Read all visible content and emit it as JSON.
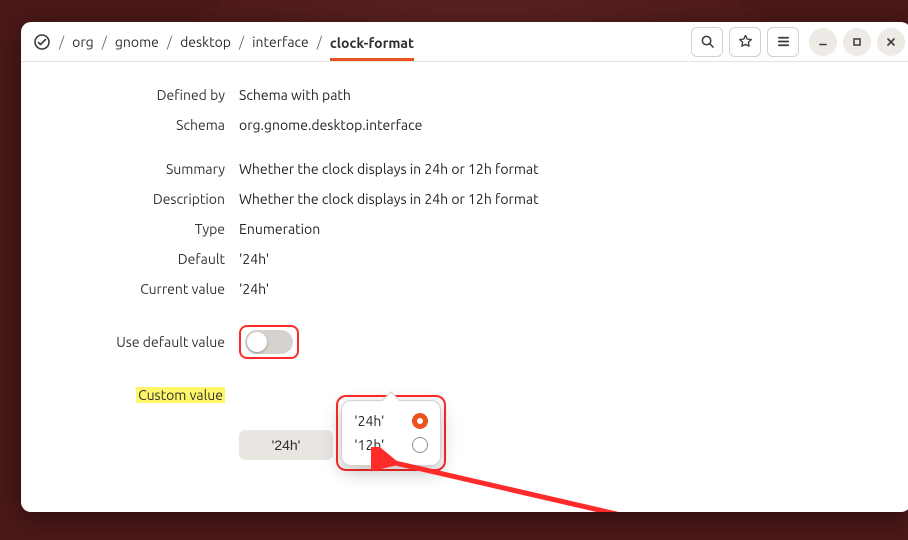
{
  "breadcrumb": {
    "items": [
      "org",
      "gnome",
      "desktop",
      "interface",
      "clock-format"
    ],
    "active_index": 4
  },
  "rows": {
    "defined_by": {
      "label": "Defined by",
      "value": "Schema with path"
    },
    "schema": {
      "label": "Schema",
      "value": "org.gnome.desktop.interface"
    },
    "summary": {
      "label": "Summary",
      "value": "Whether the clock displays in 24h or 12h format"
    },
    "description": {
      "label": "Description",
      "value": "Whether the clock displays in 24h or 12h format"
    },
    "type": {
      "label": "Type",
      "value": "Enumeration"
    },
    "default": {
      "label": "Default",
      "value": "'24h'"
    },
    "current": {
      "label": "Current value",
      "value": "'24h'"
    },
    "use_default": {
      "label": "Use default value",
      "on": false
    },
    "custom": {
      "label": "Custom value",
      "selected": "'24h'",
      "options": [
        {
          "label": "'24h'",
          "selected": true
        },
        {
          "label": "'12h'",
          "selected": false
        }
      ]
    }
  },
  "icons": {
    "app": "dconf-editor-icon",
    "search": "search-icon",
    "star": "star-icon",
    "menu": "hamburger-icon",
    "minimize": "minimize-icon",
    "maximize": "maximize-icon",
    "close": "close-icon"
  },
  "colors": {
    "accent": "#e95420",
    "annotation": "#ff2a2a"
  }
}
